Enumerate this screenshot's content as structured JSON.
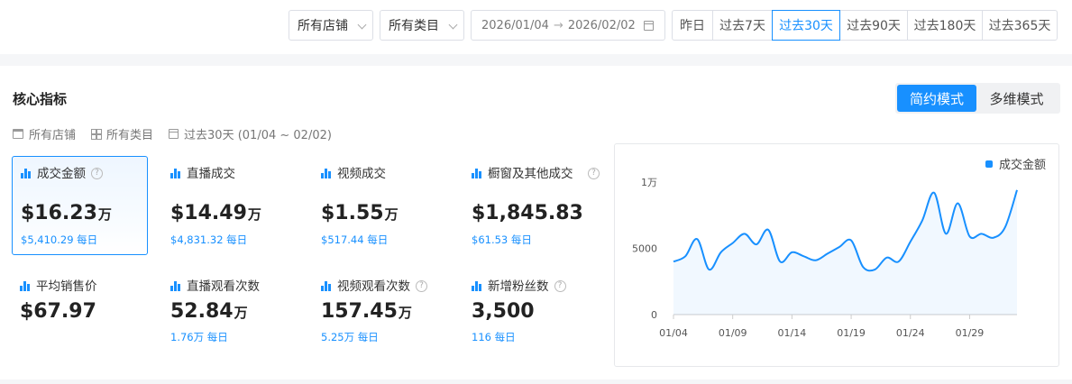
{
  "filters": {
    "shop_select": "所有店铺",
    "category_select": "所有类目",
    "date_start": "2026/01/04",
    "date_arrow": "→",
    "date_end": "2026/02/02",
    "ranges": [
      "昨日",
      "过去7天",
      "过去30天",
      "过去90天",
      "过去180天",
      "过去365天"
    ],
    "active_range": "过去30天"
  },
  "panel": {
    "title": "核心指标",
    "modes": [
      "简约模式",
      "多维模式"
    ],
    "active_mode": "简约模式",
    "meta_shop": "所有店铺",
    "meta_category": "所有类目",
    "meta_period": "过去30天 (01/04 ~ 02/02)"
  },
  "metrics": [
    {
      "label": "成交金额",
      "value": "$16.23",
      "unit": "万",
      "sub": "$5,410.29 每日",
      "help": true,
      "selected": true
    },
    {
      "label": "直播成交",
      "value": "$14.49",
      "unit": "万",
      "sub": "$4,831.32 每日",
      "help": false,
      "selected": false
    },
    {
      "label": "视频成交",
      "value": "$1.55",
      "unit": "万",
      "sub": "$517.44 每日",
      "help": false,
      "selected": false
    },
    {
      "label": "橱窗及其他成交",
      "value": "$1,845.83",
      "unit": "",
      "sub": "$61.53 每日",
      "help": true,
      "selected": false
    },
    {
      "label": "平均销售价",
      "value": "$67.97",
      "unit": "",
      "sub": "",
      "help": false,
      "selected": false
    },
    {
      "label": "直播观看次数",
      "value": "52.84",
      "unit": "万",
      "sub": "1.76万 每日",
      "help": false,
      "selected": false
    },
    {
      "label": "视频观看次数",
      "value": "157.45",
      "unit": "万",
      "sub": "5.25万 每日",
      "help": true,
      "selected": false
    },
    {
      "label": "新增粉丝数",
      "value": "3,500",
      "unit": "",
      "sub": "116 每日",
      "help": true,
      "selected": false
    }
  ],
  "chart_data": {
    "type": "area",
    "legend": [
      "成交金额"
    ],
    "legend_position": "top-right",
    "color": "#1890ff",
    "ylim": [
      0,
      10000
    ],
    "yticks": [
      0,
      5000,
      10000
    ],
    "ytick_labels": [
      "0",
      "5000",
      "1万"
    ],
    "xtick_labels": [
      "01/04",
      "01/09",
      "01/14",
      "01/19",
      "01/24",
      "01/29"
    ],
    "grid": false,
    "series": [
      {
        "name": "成交金额",
        "x": [
          "01/04",
          "01/05",
          "01/06",
          "01/07",
          "01/08",
          "01/09",
          "01/10",
          "01/11",
          "01/12",
          "01/13",
          "01/14",
          "01/15",
          "01/16",
          "01/17",
          "01/18",
          "01/19",
          "01/20",
          "01/21",
          "01/22",
          "01/23",
          "01/24",
          "01/25",
          "01/26",
          "01/27",
          "01/28",
          "01/29",
          "01/30",
          "01/31",
          "02/01",
          "02/02"
        ],
        "values": [
          4000,
          4400,
          5700,
          3400,
          4700,
          5400,
          6100,
          5300,
          6400,
          4000,
          4700,
          4400,
          4100,
          4600,
          5100,
          5600,
          3600,
          3400,
          4300,
          4000,
          5500,
          7100,
          9200,
          6100,
          8400,
          5900,
          6100,
          5800,
          6600,
          9400
        ]
      }
    ]
  }
}
